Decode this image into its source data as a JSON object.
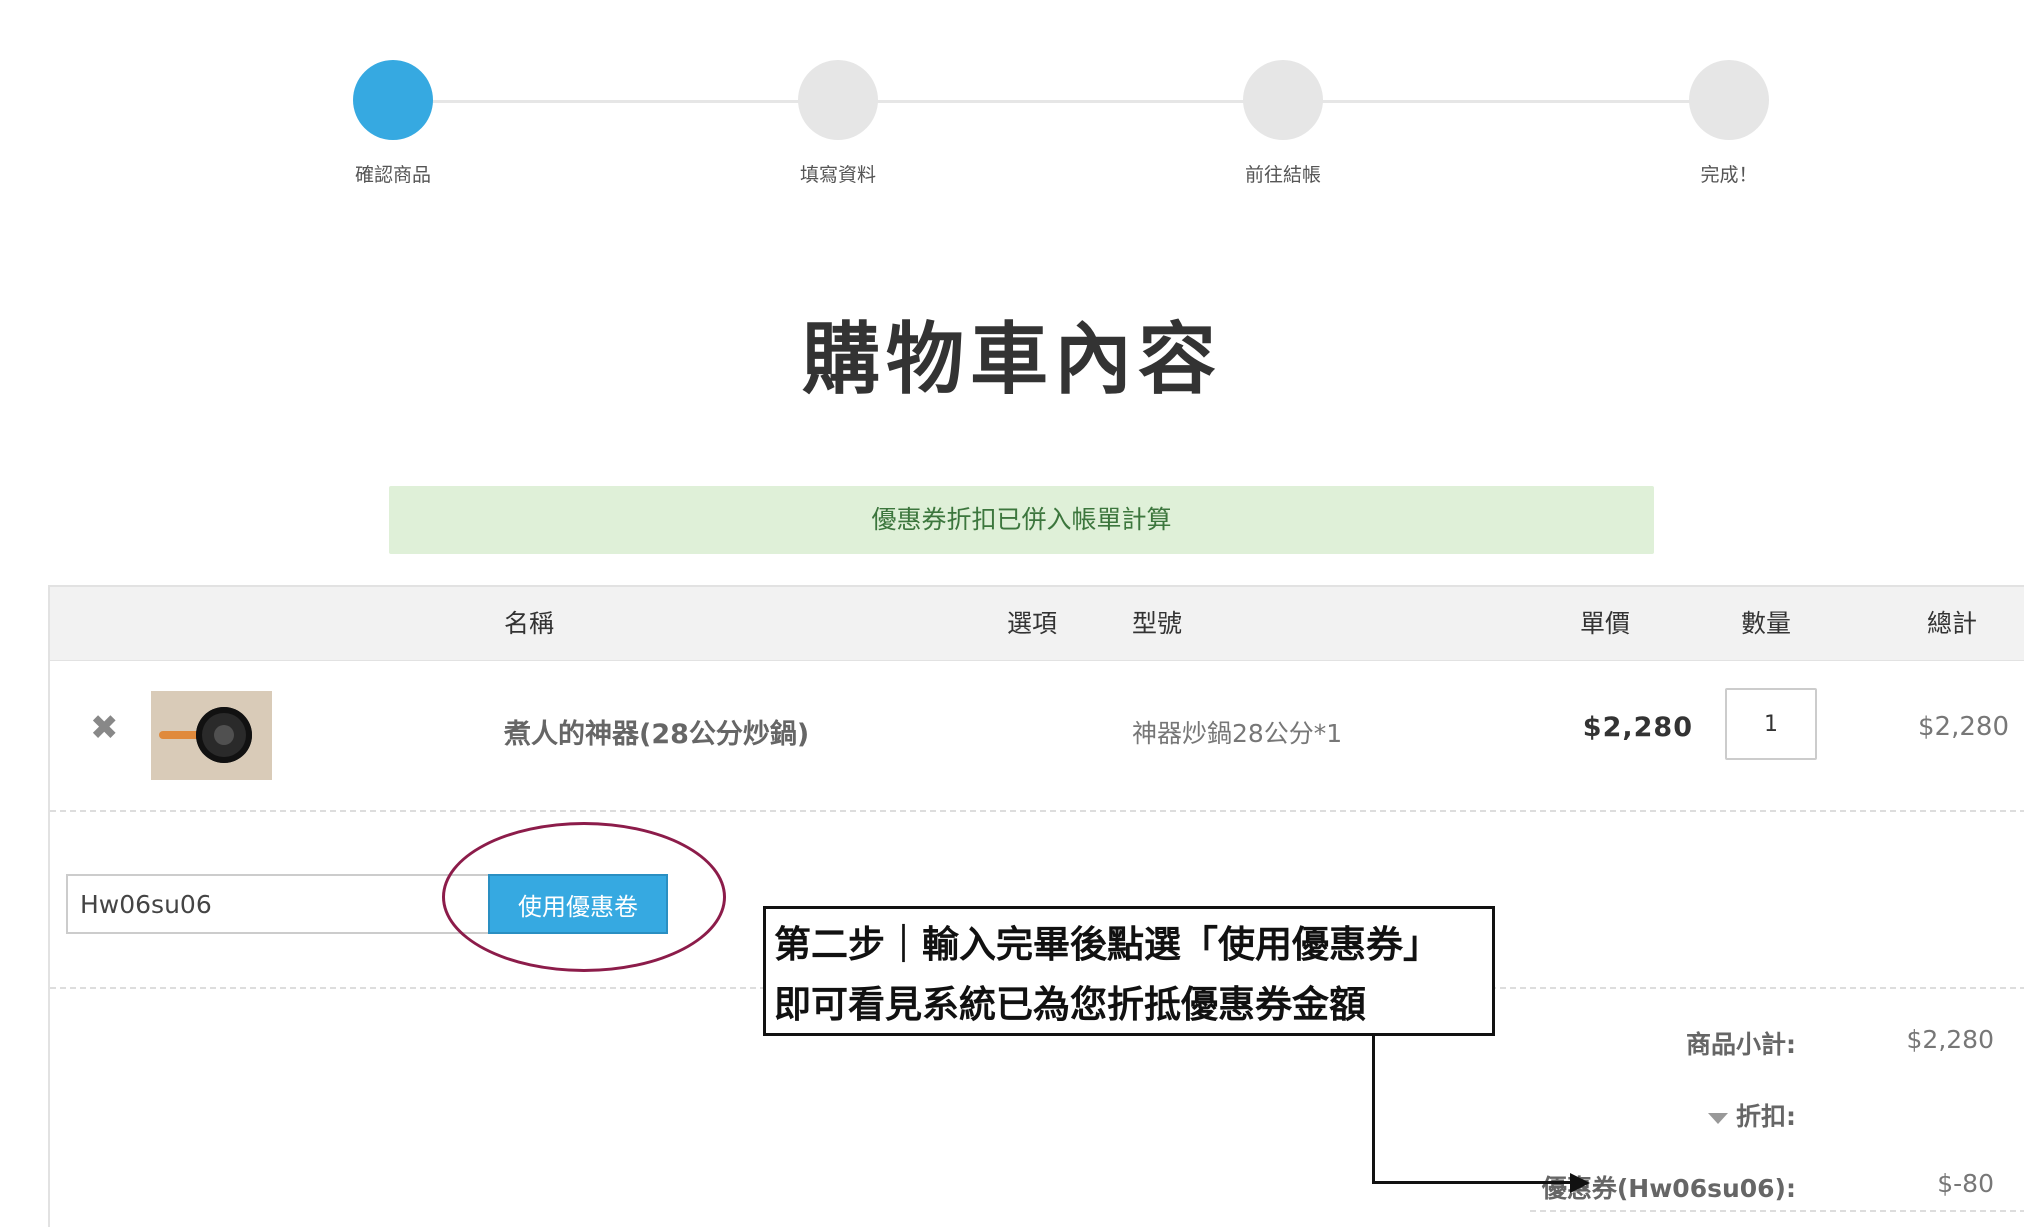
{
  "steps": [
    {
      "label": "確認商品",
      "active": true
    },
    {
      "label": "填寫資料",
      "active": false
    },
    {
      "label": "前往結帳",
      "active": false
    },
    {
      "label": "完成！",
      "active": false
    }
  ],
  "page_title": "購物車內容",
  "notice": "優惠券折扣已併入帳單計算",
  "table": {
    "headers": {
      "name": "名稱",
      "option": "選項",
      "model": "型號",
      "unit_price": "單價",
      "quantity": "數量",
      "total": "總計"
    },
    "rows": [
      {
        "name": "煮人的神器(28公分炒鍋)",
        "model": "神器炒鍋28公分*1",
        "unit_price": "$2,280",
        "quantity": "1",
        "total": "$2,280"
      }
    ]
  },
  "coupon": {
    "value": "Hw06su06",
    "button_label": "使用優惠卷"
  },
  "summary": {
    "subtotal_label": "商品小計:",
    "subtotal_value": "$2,280",
    "discount_label": "折扣:",
    "coupon_label": "優惠券(Hw06su06):",
    "coupon_value": "$-80"
  },
  "annotation": {
    "line1": "第二步｜輸入完畢後點選「使用優惠券」",
    "line2": "即可看見系統已為您折抵優惠券金額"
  },
  "colors": {
    "accent": "#36a9e1",
    "notice_bg": "#dff0d8",
    "notice_text": "#3c763d",
    "ellipse": "#8c1c4a"
  }
}
